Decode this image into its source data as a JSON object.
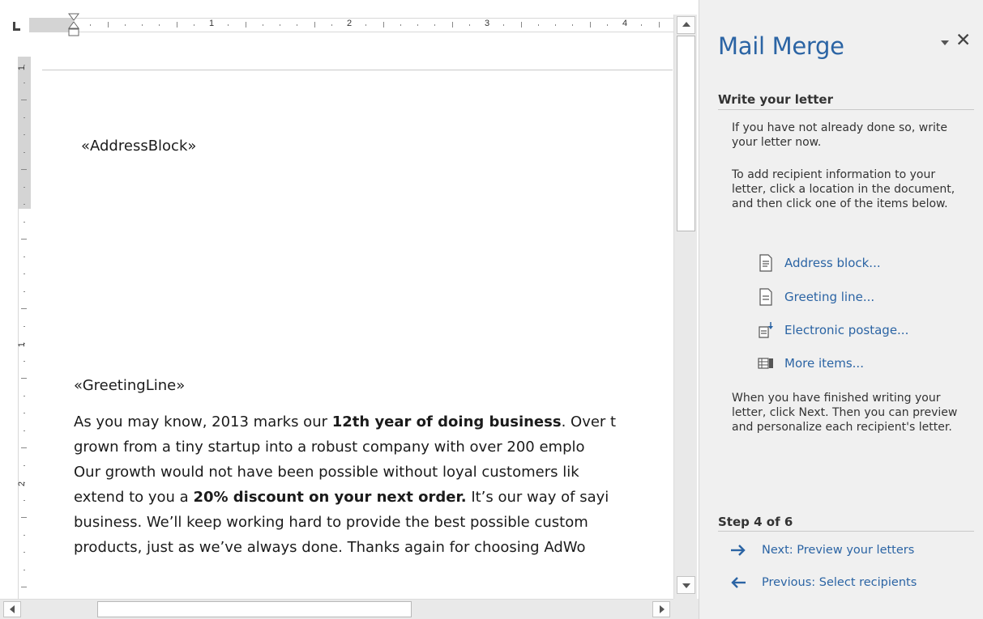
{
  "document": {
    "ruler_numbers": [
      "1",
      "2",
      "3",
      "4"
    ],
    "vertical_ruler_numbers": [
      "1",
      "1",
      "2"
    ],
    "address_block": "«AddressBlock»",
    "greeting_line": "«GreetingLine»",
    "body_lines": [
      {
        "before": "As you may know, 2013 marks our ",
        "bold": "12th year of doing business",
        "after": ". Over t"
      },
      {
        "before": "grown from a tiny startup into a robust company with over 200 emplo",
        "bold": "",
        "after": ""
      },
      {
        "before": "Our growth would not have been possible without loyal customers lik",
        "bold": "",
        "after": ""
      },
      {
        "before": "extend to you a ",
        "bold": "20% discount on your next order.",
        "after": " It’s our way of sayi"
      },
      {
        "before": "business. We’ll keep working hard to provide the best possible custom",
        "bold": "",
        "after": ""
      },
      {
        "before": "products, just as we’ve always done. Thanks again for choosing AdWo",
        "bold": "",
        "after": ""
      }
    ]
  },
  "pane": {
    "title": "Mail Merge",
    "close_glyph": "✕",
    "write_header": "Write your letter",
    "intro_text": "If you have not already done so, write your letter now.",
    "instructions_text": "To add recipient information to your letter, click a location in the document, and then click one of the items below.",
    "items": [
      {
        "label": "Address block...",
        "icon": "address-block-icon"
      },
      {
        "label": "Greeting line...",
        "icon": "greeting-line-icon"
      },
      {
        "label": "Electronic postage...",
        "icon": "electronic-postage-icon"
      },
      {
        "label": "More items...",
        "icon": "more-items-icon"
      }
    ],
    "finish_text": "When you have finished writing your letter, click Next. Then you can preview and personalize each recipient's letter.",
    "step_label": "Step 4 of 6",
    "next_label": "Next: Preview your letters",
    "previous_label": "Previous: Select recipients",
    "colors": {
      "accent": "#2b64a4",
      "pane_bg": "#f0f0f0"
    }
  }
}
